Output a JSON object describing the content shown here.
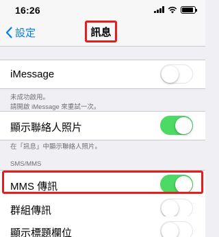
{
  "status_bar": {
    "time": "16:26",
    "battery_level": 0.9
  },
  "nav": {
    "back_label": "設定",
    "title": "訊息"
  },
  "imessage": {
    "label": "iMessage",
    "enabled": false,
    "footer": [
      "未成功啟用。",
      "請開啟 iMessage 來重試一次。"
    ]
  },
  "contact_photos": {
    "label": "顯示聯絡人照片",
    "enabled": true,
    "footer": "在「訊息」中顯示聯絡人照片。"
  },
  "sms_section": {
    "header": "SMS/MMS",
    "items": [
      {
        "label": "MMS 傳訊",
        "enabled": true
      },
      {
        "label": "群組傳訊",
        "enabled": false
      },
      {
        "label": "顯示標題欄位",
        "enabled": false
      }
    ]
  },
  "colors": {
    "accent": "#007aff",
    "toggle_on": "#4cd964",
    "highlight": "#e02020"
  }
}
